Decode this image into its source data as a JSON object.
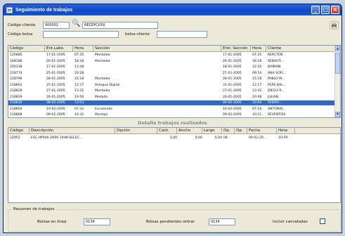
{
  "window": {
    "title": "Seguimiento de trabajos"
  },
  "filters": {
    "codigo_cliente_label": "Código cliente",
    "codigo_cliente_value": "000001",
    "cliente_name": "RECEPCION",
    "codigo_bolsa_label": "Código bolsa",
    "bolsa_cliente_label": "bolsa cliente"
  },
  "jobs": {
    "columns": [
      "Código",
      "Ent.Labo.",
      "Hora",
      "Sección",
      "Entr. Sección",
      "Hora",
      "Cliente"
    ],
    "rows": [
      [
        "126885",
        "17-01-2005",
        "07:35",
        "Montador",
        "17-01-2005",
        "07:35",
        "KERCTEN"
      ],
      [
        "168188",
        "26-01-2005",
        "18:28",
        "Montador",
        "26-01-2005",
        "18:28",
        "SEBASTI..."
      ],
      [
        "205338",
        "17-01-2005",
        "13:48",
        "",
        "18-01-2005",
        "12:50",
        "DAMIAN"
      ],
      [
        "218774",
        "25-01-2005",
        "10:28",
        "",
        "27-01-2005",
        "09:54",
        "ANA SOFI..."
      ],
      [
        "218796",
        "28-01-2005",
        "15:18",
        "Montador",
        "28-01-2005",
        "15:18",
        "PABLO M..."
      ],
      [
        "218803",
        "25-01-2005",
        "12:27",
        "Retoque Digital",
        "31-01-2005",
        "12:17",
        "PEPE BAL..."
      ],
      [
        "218828",
        "27-01-2005",
        "13:32",
        "Montador",
        "27-01-2005",
        "13:32",
        "DIEGO R..."
      ],
      [
        "218829",
        "26-01-2005",
        "19:56",
        "Medalla",
        "26-01-2005",
        "20:48",
        "JULIAN"
      ],
      [
        "218830",
        "08-02-2005",
        "13:53",
        "",
        "09-02-2005",
        "10:04",
        "PEDRO..."
      ],
      [
        "218854",
        "10-02-2005",
        "07:32",
        "Escaneado",
        "10-02-2005",
        "07:16",
        "ANTONIO..."
      ],
      [
        "218868",
        "09-02-2005",
        "10:32",
        "Montaje",
        "09-02-2005",
        "10:11",
        "SEVENTIES"
      ]
    ],
    "selected_index": 8
  },
  "details": {
    "section_title": "Detalle trabajos realizados",
    "columns": [
      "Código",
      "Descripción",
      "Opción",
      "Cant.",
      "Ancho",
      "Largo",
      "Op.",
      "Op.",
      "Fecha",
      "Hora"
    ],
    "rows": [
      [
        "22952",
        "ESC.HP500 2H06 10H8 SELEC...",
        "",
        "3,00",
        "0,00",
        "0,00",
        "06",
        "",
        "09-02-20...",
        "10:59"
      ]
    ]
  },
  "summary": {
    "group_label": "Resumen de trabajos",
    "bolsas_en_linea_label": "Bolsas en línea",
    "bolsas_en_linea_value": "0134",
    "bolsas_pendientes_label": "Bolsas pendientes retirar",
    "bolsas_pendientes_value": "0134",
    "incluir_canceladas_label": "Incluir canceladas"
  },
  "colors": {
    "titlebar": "#0c48c8",
    "selection": "#316ac5",
    "window_bg": "#ece9d8"
  }
}
